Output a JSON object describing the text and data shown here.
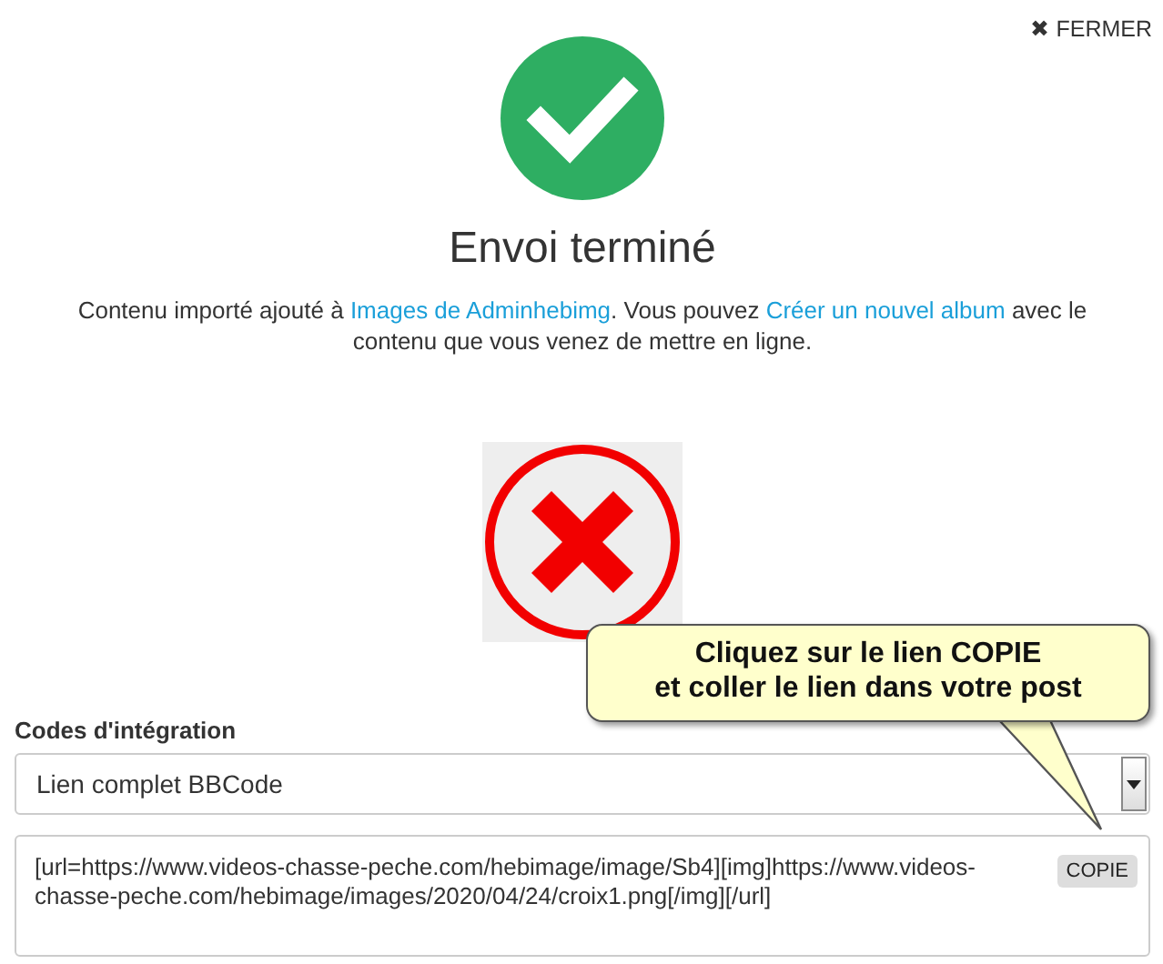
{
  "close_button": {
    "icon": "✖",
    "label": "FERMER"
  },
  "title": "Envoi terminé",
  "message": [
    {
      "kind": "text",
      "text": "Contenu importé ajouté à "
    },
    {
      "kind": "link",
      "text": "Images de Adminhebimg"
    },
    {
      "kind": "text",
      "text": ". Vous pouvez "
    },
    {
      "kind": "link",
      "text": "Créer un nouvel album"
    },
    {
      "kind": "text",
      "text": " avec le contenu que vous venez de mettre en ligne."
    }
  ],
  "embed": {
    "label": "Codes d'intégration",
    "select_value": "Lien complet BBCode",
    "code": "[url=https://www.videos-chasse-peche.com/hebimage/image/Sb4][img]https://www.videos-chasse-peche.com/hebimage/images/2020/04/24/croix1.png[/img][/url]",
    "copy_button": "COPIE"
  },
  "callout": {
    "lines": [
      "Cliquez sur le lien COPIE",
      "et coller le lien dans votre post"
    ]
  }
}
